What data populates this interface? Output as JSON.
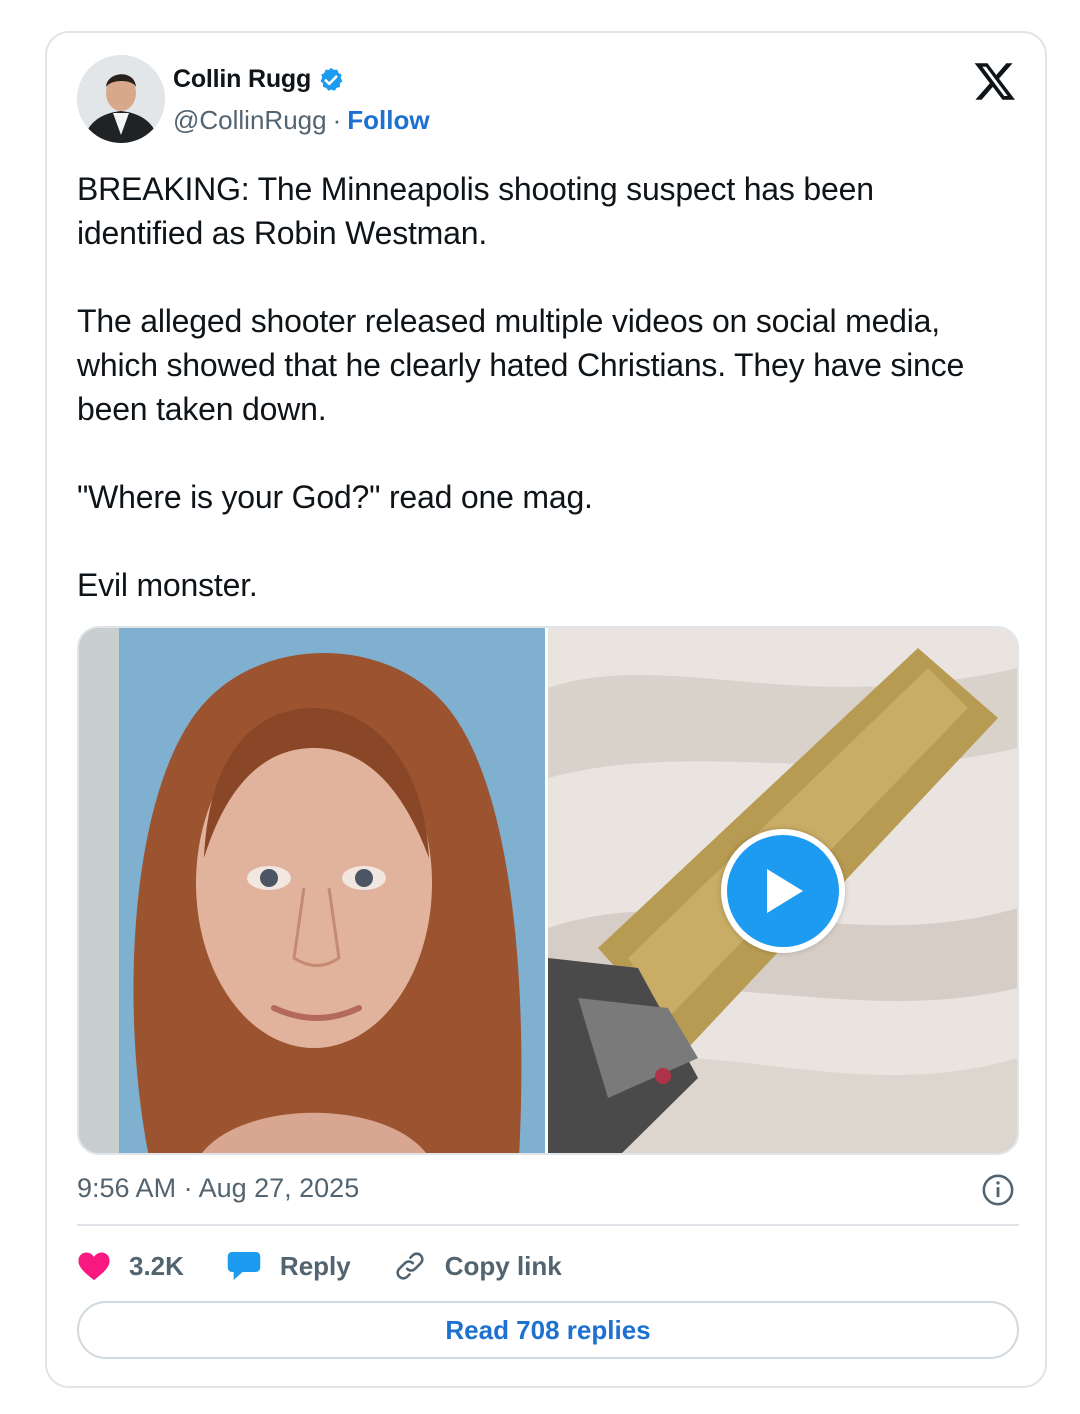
{
  "author": {
    "name": "Collin Rugg",
    "handle": "@CollinRugg",
    "separator": "·",
    "follow_label": "Follow"
  },
  "post": {
    "paragraphs": [
      "BREAKING: The Minneapolis shooting suspect has been identified as Robin Westman.",
      "The alleged shooter released multiple videos on social media, which showed that he clearly hated Christians. They have since been taken down.",
      "\"Where is your God?\" read one mag.",
      "Evil monster."
    ],
    "timestamp": "9:56 AM · Aug 27, 2025"
  },
  "media": {
    "items": [
      {
        "kind": "photo",
        "description_icon": "photo"
      },
      {
        "kind": "video",
        "has_play_button": true
      }
    ]
  },
  "actions": {
    "like_count": "3.2K",
    "reply_label": "Reply",
    "copy_link_label": "Copy link"
  },
  "read_replies_label": "Read 708 replies",
  "colors": {
    "link_blue": "#1d71d0",
    "verified_blue": "#1d9bf0",
    "like_pink": "#f91880",
    "secondary_text": "#536471"
  }
}
